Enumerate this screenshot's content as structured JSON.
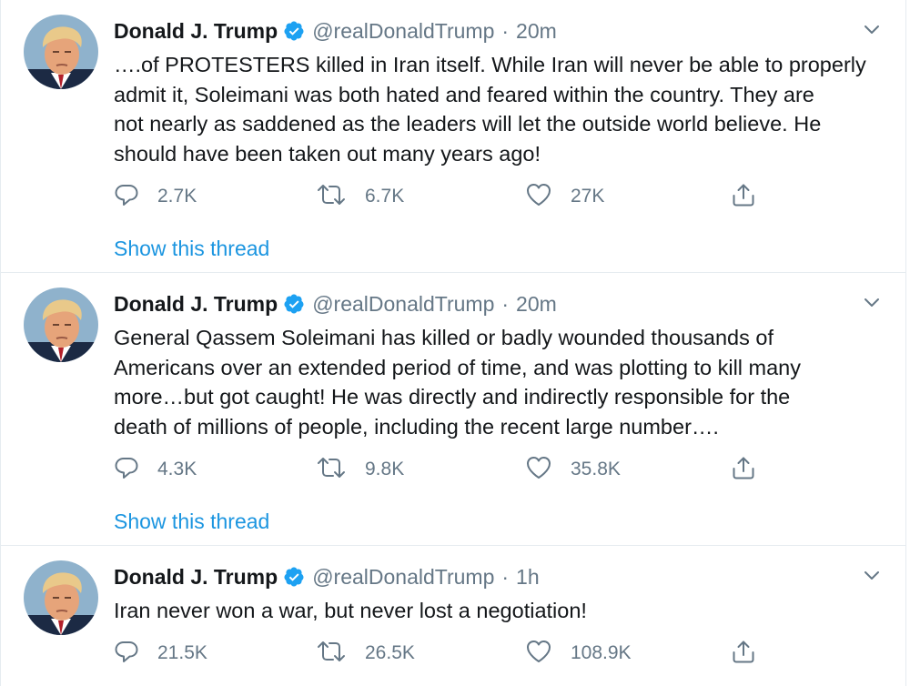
{
  "tweets": [
    {
      "name": "Donald J. Trump",
      "handle": "@realDonaldTrump",
      "separator": "·",
      "time": "20m",
      "lines": [
        "….of PROTESTERS killed in Iran itself. While Iran will never be able to properly",
        "admit it, Soleimani was both hated and feared within the country. They are",
        "not nearly as saddened as the leaders will let the outside world believe. He",
        "should have been taken out many years ago!"
      ],
      "replies": "2.7K",
      "retweets": "6.7K",
      "likes": "27K",
      "show_thread": "Show this thread"
    },
    {
      "name": "Donald J. Trump",
      "handle": "@realDonaldTrump",
      "separator": "·",
      "time": "20m",
      "lines": [
        "General Qassem Soleimani has killed or badly wounded thousands of",
        "Americans over an extended period of time, and was plotting to kill many",
        "more…but got caught! He was directly and indirectly responsible for the",
        "death of millions of people, including the recent large number…."
      ],
      "replies": "4.3K",
      "retweets": "9.8K",
      "likes": "35.8K",
      "show_thread": "Show this thread"
    },
    {
      "name": "Donald J. Trump",
      "handle": "@realDonaldTrump",
      "separator": "·",
      "time": "1h",
      "lines": [
        "Iran never won a war, but never lost a negotiation!"
      ],
      "replies": "21.5K",
      "retweets": "26.5K",
      "likes": "108.9K"
    }
  ],
  "icons": {
    "verified": "verified-badge-icon",
    "caret": "chevron-down-icon",
    "reply": "reply-icon",
    "retweet": "retweet-icon",
    "like": "heart-icon",
    "share": "share-icon"
  },
  "colors": {
    "accent": "#1b95e0",
    "verified": "#1da1f2",
    "secondary_text": "#657786",
    "divider": "#e6ecf0"
  }
}
